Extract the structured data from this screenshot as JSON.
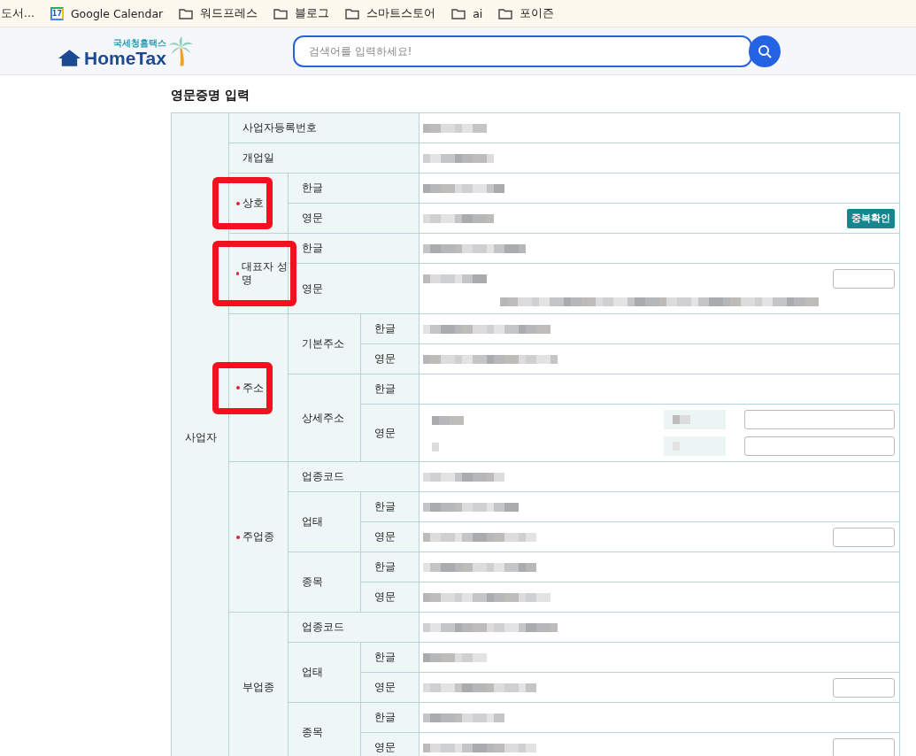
{
  "bookmarks": [
    {
      "label": "도서...",
      "kind": "plain"
    },
    {
      "label": "Google Calendar",
      "kind": "calendar",
      "icon_text": "17"
    },
    {
      "label": "워드프레스",
      "kind": "folder"
    },
    {
      "label": "블로그",
      "kind": "folder"
    },
    {
      "label": "스마트스토어",
      "kind": "folder"
    },
    {
      "label": "ai",
      "kind": "folder"
    },
    {
      "label": "포이즌",
      "kind": "folder"
    }
  ],
  "header": {
    "logo_top": "국세청홈택스",
    "logo_main": "HomeTax",
    "search": {
      "placeholder": "검색어를 입력하세요!"
    }
  },
  "title": "영문증명 입력",
  "table": {
    "section": "사업자",
    "rows": [
      {
        "label": "사업자등록번호",
        "required": false,
        "annotated": false,
        "kind": "text"
      },
      {
        "label": "개업일",
        "required": false,
        "annotated": false,
        "kind": "text"
      },
      {
        "label": "상호",
        "required": true,
        "annotated": true,
        "children": [
          {
            "label": "한글",
            "kind": "text"
          },
          {
            "label": "영문",
            "kind": "button",
            "button": "중복확인"
          }
        ]
      },
      {
        "label": "대표자 성명",
        "required": true,
        "annotated": true,
        "children": [
          {
            "label": "한글",
            "kind": "text"
          },
          {
            "label": "영문",
            "kind": "wrapped-field"
          }
        ]
      },
      {
        "label": "주소",
        "required": true,
        "annotated": true,
        "children": [
          {
            "label": "기본주소",
            "children": [
              {
                "label": "한글",
                "kind": "text"
              },
              {
                "label": "영문",
                "kind": "text"
              }
            ]
          },
          {
            "label": "상세주소",
            "children": [
              {
                "label": "한글",
                "kind": "empty"
              },
              {
                "label": "영문",
                "kind": "split-fields"
              }
            ]
          }
        ]
      },
      {
        "label": "주업종",
        "required": true,
        "annotated": false,
        "children": [
          {
            "label": "업종코드",
            "kind": "text"
          },
          {
            "label": "업태",
            "children": [
              {
                "label": "한글",
                "kind": "text"
              },
              {
                "label": "영문",
                "kind": "field"
              }
            ]
          },
          {
            "label": "종목",
            "children": [
              {
                "label": "한글",
                "kind": "text"
              },
              {
                "label": "영문",
                "kind": "text"
              }
            ]
          }
        ]
      },
      {
        "label": "부업종",
        "required": false,
        "annotated": false,
        "children": [
          {
            "label": "업종코드",
            "kind": "text"
          },
          {
            "label": "업태",
            "children": [
              {
                "label": "한글",
                "kind": "text"
              },
              {
                "label": "영문",
                "kind": "field"
              }
            ]
          },
          {
            "label": "종목",
            "children": [
              {
                "label": "한글",
                "kind": "text"
              },
              {
                "label": "영문",
                "kind": "field"
              }
            ]
          }
        ]
      }
    ]
  }
}
